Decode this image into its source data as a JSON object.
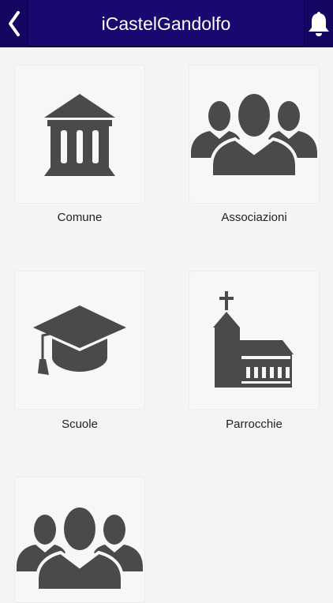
{
  "header": {
    "title": "iCastelGandolfo",
    "back_icon": "chevron-left-icon",
    "bell_icon": "bell-icon"
  },
  "tiles": [
    {
      "label": "Comune",
      "icon": "town-hall-icon"
    },
    {
      "label": "Associazioni",
      "icon": "group-icon"
    },
    {
      "label": "Scuole",
      "icon": "graduation-cap-icon"
    },
    {
      "label": "Parrocchie",
      "icon": "church-icon"
    },
    {
      "label": "",
      "icon": "group-icon"
    }
  ],
  "colors": {
    "header_bg": "#1a0870",
    "icon": "#4a4a4a",
    "background": "#f4f4f4"
  }
}
